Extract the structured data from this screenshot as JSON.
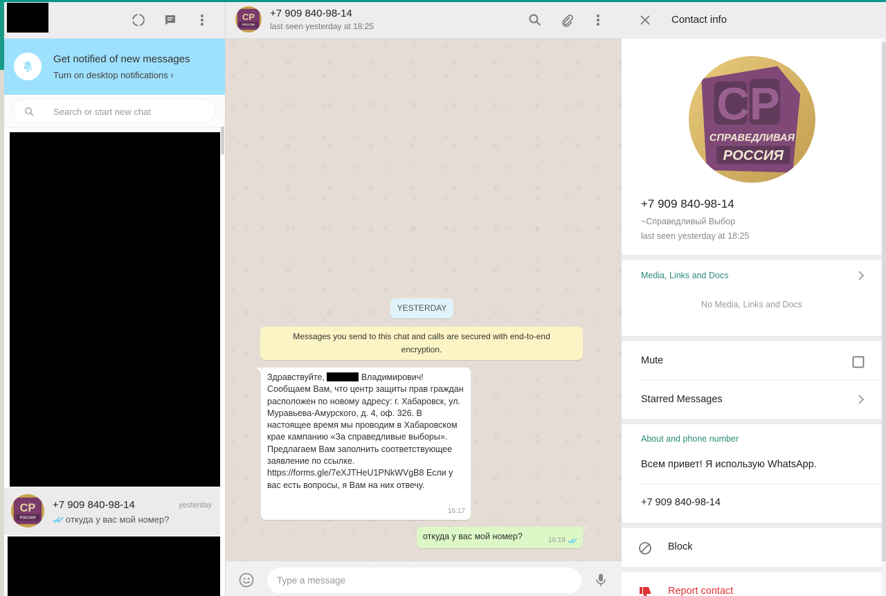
{
  "sidebar": {
    "notify_title": "Get notified of new messages",
    "notify_sub": "Turn on desktop notifications ›",
    "search_placeholder": "Search or start new chat",
    "chat": {
      "name": "+7 909 840-98-14",
      "time": "yesterday",
      "last_message": "откуда у вас мой номер?"
    }
  },
  "conversation": {
    "contact_name": "+7 909 840-98-14",
    "status": "last seen yesterday at 18:25",
    "date_chip": "YESTERDAY",
    "encryption_notice": "Messages you send to this chat and calls are secured with end-to-end encryption.",
    "incoming": {
      "text_a": "Здравствуйте,",
      "text_b": "Владимирович! Сообщаем Вам, что центр защиты прав граждан расположен по новому адресу: г. Хабаровск, ул. Муравьева-Амурского, д. 4, оф. 326. В настоящее время мы проводим в Хабаровском крае кампанию «За справедливые выборы». Предлагаем Вам заполнить соответствующее заявление по ссылке. https://forms.gle/7eXJTHeU1PNkWVgB8 Если у вас есть вопросы, я Вам на них отвечу.",
      "time": "16:17"
    },
    "outgoing": {
      "text": "откуда у вас мой номер?",
      "time": "16:18"
    },
    "input_placeholder": "Type a message"
  },
  "contact_info": {
    "title": "Contact info",
    "name": "+7 909 840-98-14",
    "group": "~Справедливый Выбор",
    "last_seen": "last seen yesterday at 18:25",
    "media_label": "Media, Links and Docs",
    "media_empty": "No Media, Links and Docs",
    "mute_label": "Mute",
    "starred_label": "Starred Messages",
    "about_label": "About and phone number",
    "about_text": "Всем привет! Я использую WhatsApp.",
    "phone": "+7 909 840-98-14",
    "block_label": "Block",
    "report_label": "Report contact"
  },
  "logo": {
    "letters": "СР",
    "line1": "СПРАВЕДЛИВАЯ",
    "line2": "РОССИЯ"
  },
  "colors": {
    "accent": "#009688",
    "banner": "#9de1fe",
    "outgoing_bubble": "#dcf8c6",
    "notice_bubble": "#fcf4c4",
    "danger": "#df3333"
  },
  "icons": [
    "status-icon",
    "new-chat-icon",
    "menu-icon",
    "bell-off-icon",
    "search-icon",
    "attach-icon",
    "close-icon",
    "chevron-right-icon",
    "checkbox-icon",
    "block-icon",
    "thumbs-down-icon",
    "emoji-icon",
    "mic-icon",
    "double-check-icon"
  ]
}
